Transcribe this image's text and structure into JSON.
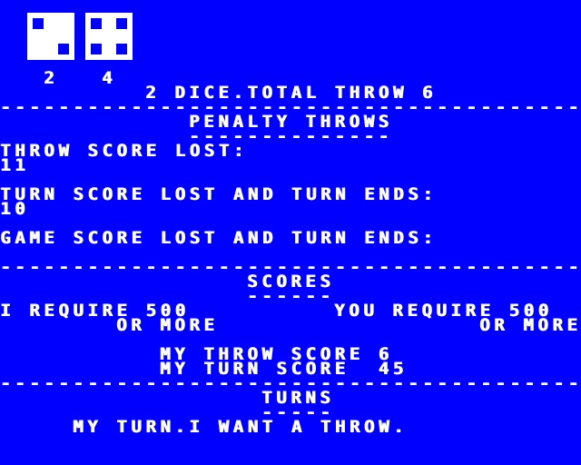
{
  "colors": {
    "background": "#0000ff",
    "foreground": "#ffffff"
  },
  "dice": [
    {
      "face": 2,
      "label": "2"
    },
    {
      "face": 4,
      "label": "4"
    }
  ],
  "status": "2 DICE.TOTAL THROW 6",
  "separator": "--------------------------------------------------------------------------------",
  "penalty": {
    "heading": "PENALTY THROWS",
    "underline": "--------------",
    "throw_lost_label": "THROW SCORE LOST:",
    "throw_lost_value": "11",
    "turn_lost_label": "TURN SCORE LOST AND TURN ENDS:",
    "turn_lost_value": "10",
    "game_lost_label": "GAME SCORE LOST AND TURN ENDS:"
  },
  "scores": {
    "heading": "SCORES",
    "underline": "------",
    "cpu_require": "I REQUIRE 500",
    "cpu_more": "OR MORE",
    "player_require": "YOU REQUIRE 500",
    "player_more": "OR MORE",
    "throw_score": "MY THROW SCORE 6",
    "turn_score": "MY TURN SCORE  45"
  },
  "turns": {
    "heading": "TURNS",
    "underline": "-----",
    "message": "MY TURN.I WANT A THROW."
  }
}
